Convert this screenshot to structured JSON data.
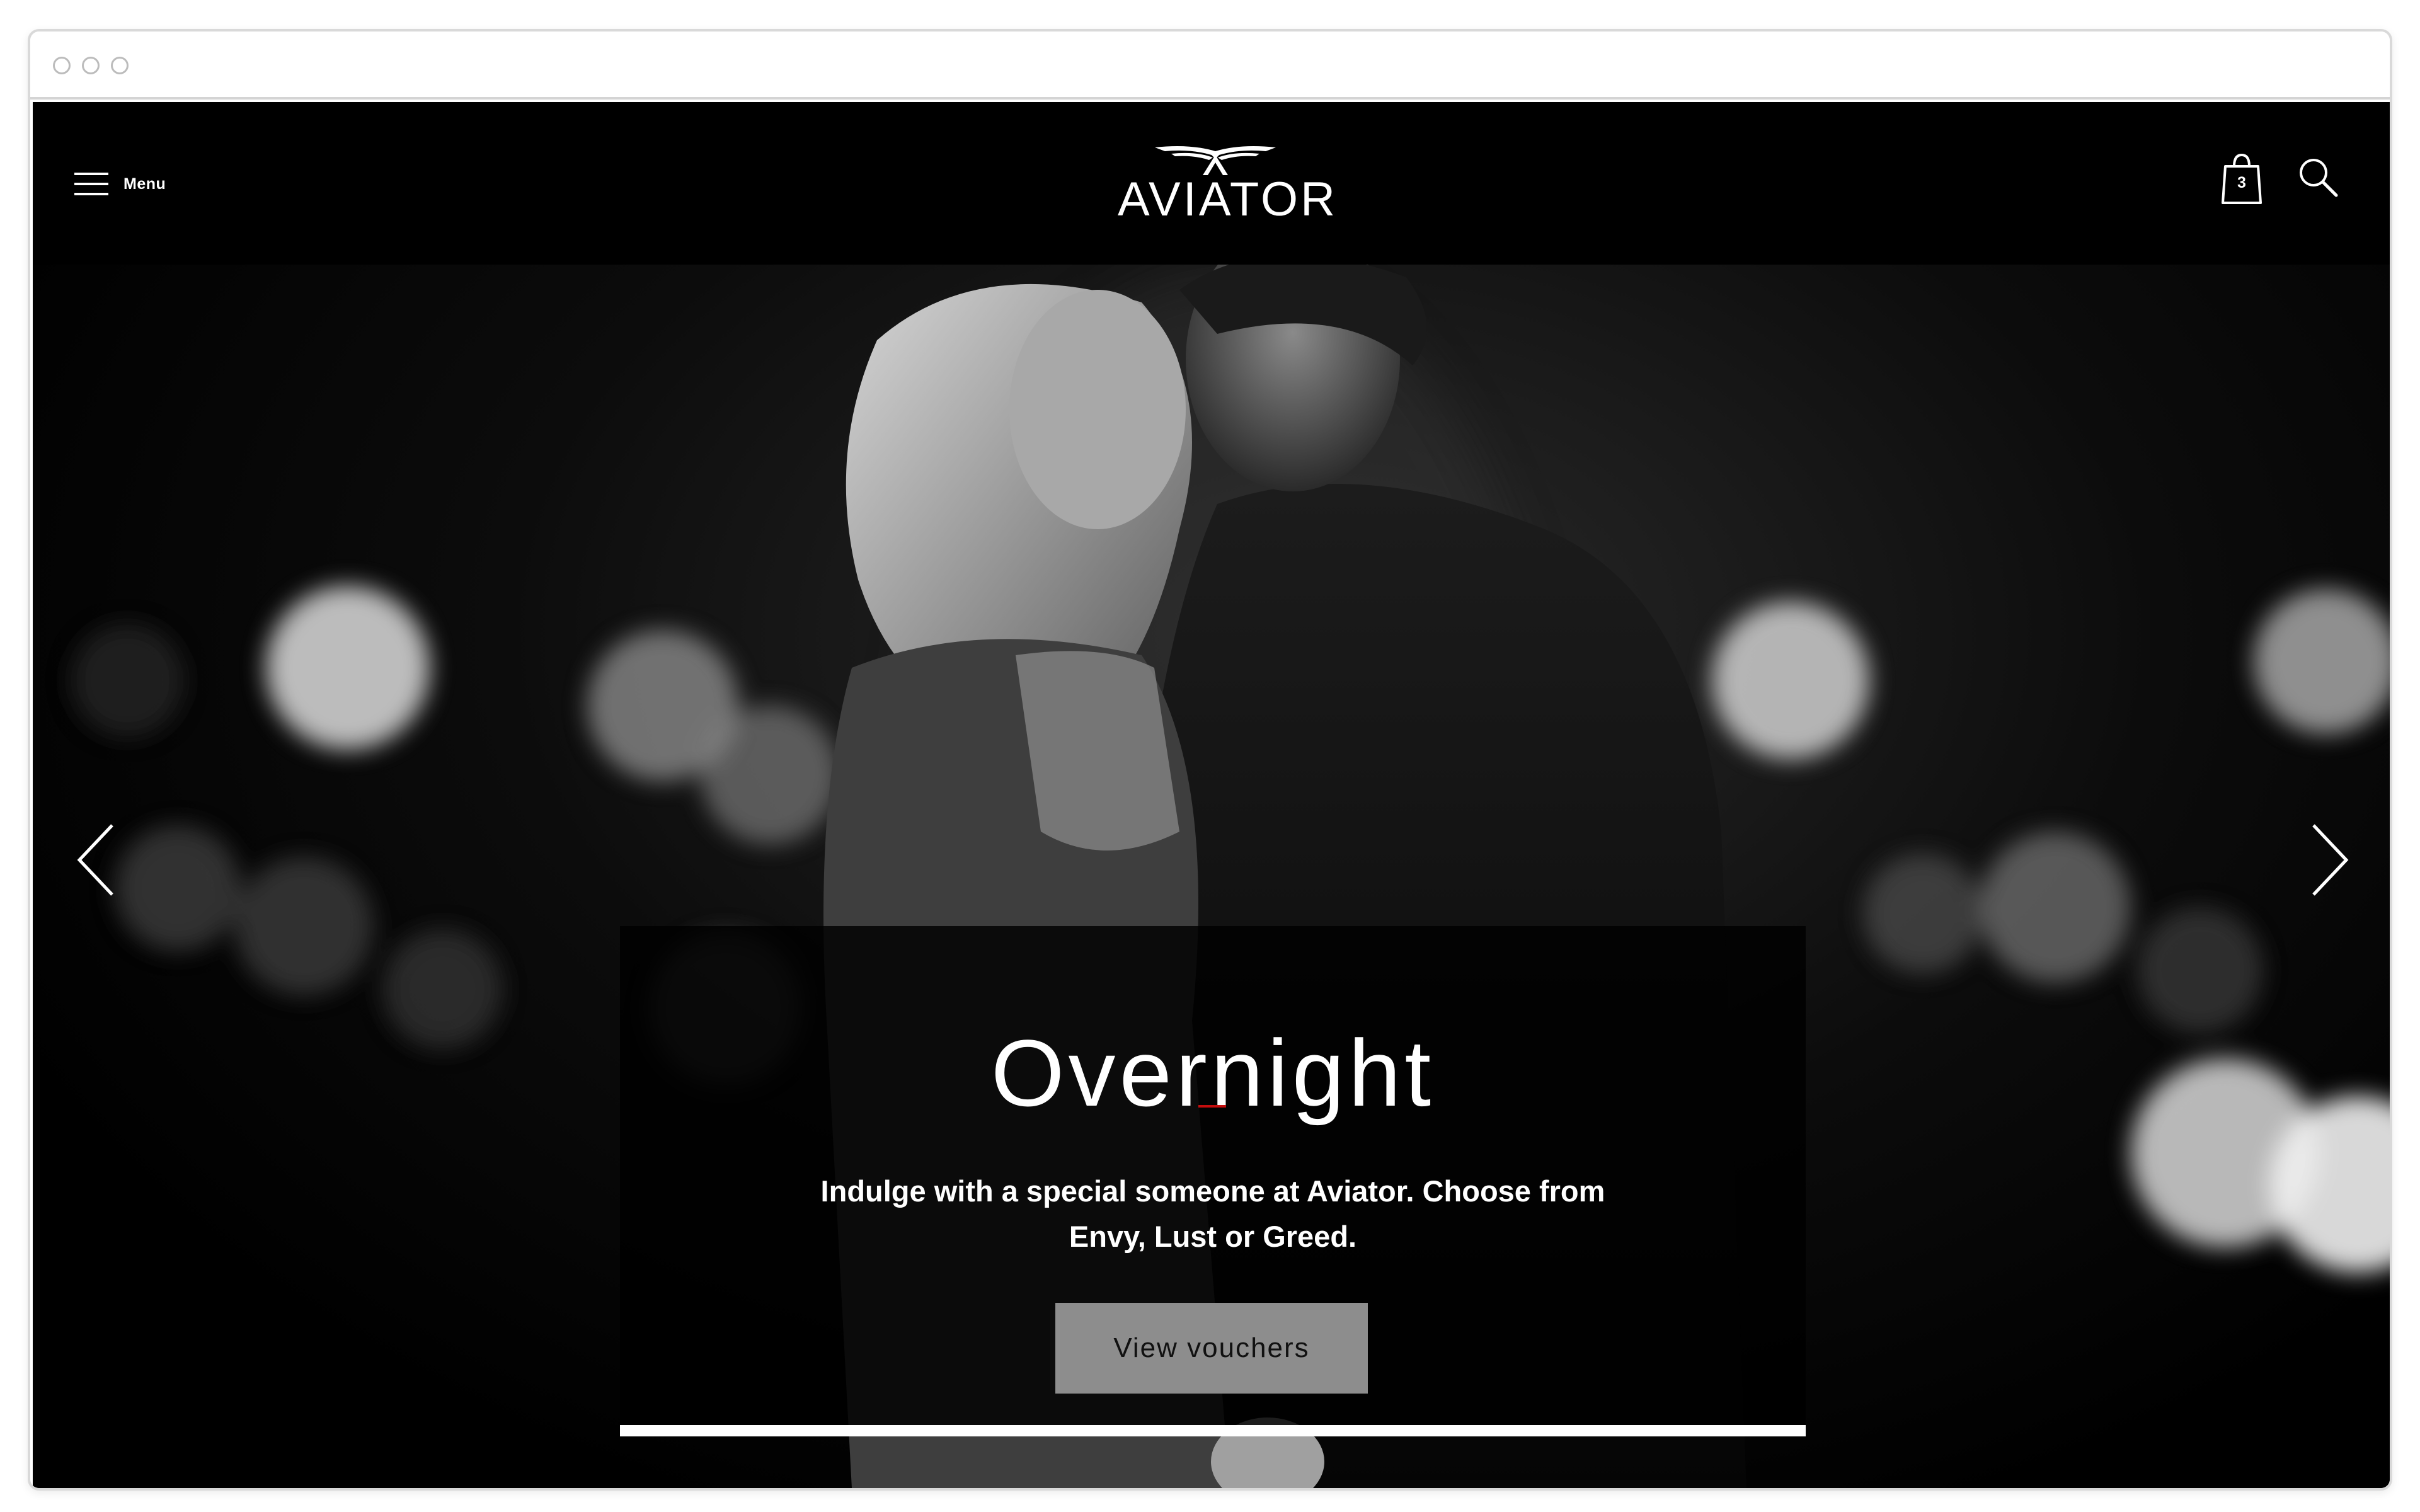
{
  "header": {
    "menu_label": "Menu",
    "logo_text": "AVIATOR",
    "cart_count": "3"
  },
  "hero": {
    "title": "Overnight",
    "description": "Indulge with a special someone at Aviator. Choose from Envy, Lust or Greed.",
    "cta_label": "View vouchers",
    "progress_fraction": 1.0
  },
  "colors": {
    "header_bg": "#000000",
    "accent_rule": "#c40d0d",
    "cta_bg": "#8d8d8d",
    "caption_bg": "rgba(0,0,0,0.82)"
  },
  "icons": {
    "menu": "hamburger-icon",
    "cart": "shopping-bag-icon",
    "search": "search-icon",
    "prev": "chevron-left-icon",
    "next": "chevron-right-icon",
    "logo": "wings-icon"
  }
}
